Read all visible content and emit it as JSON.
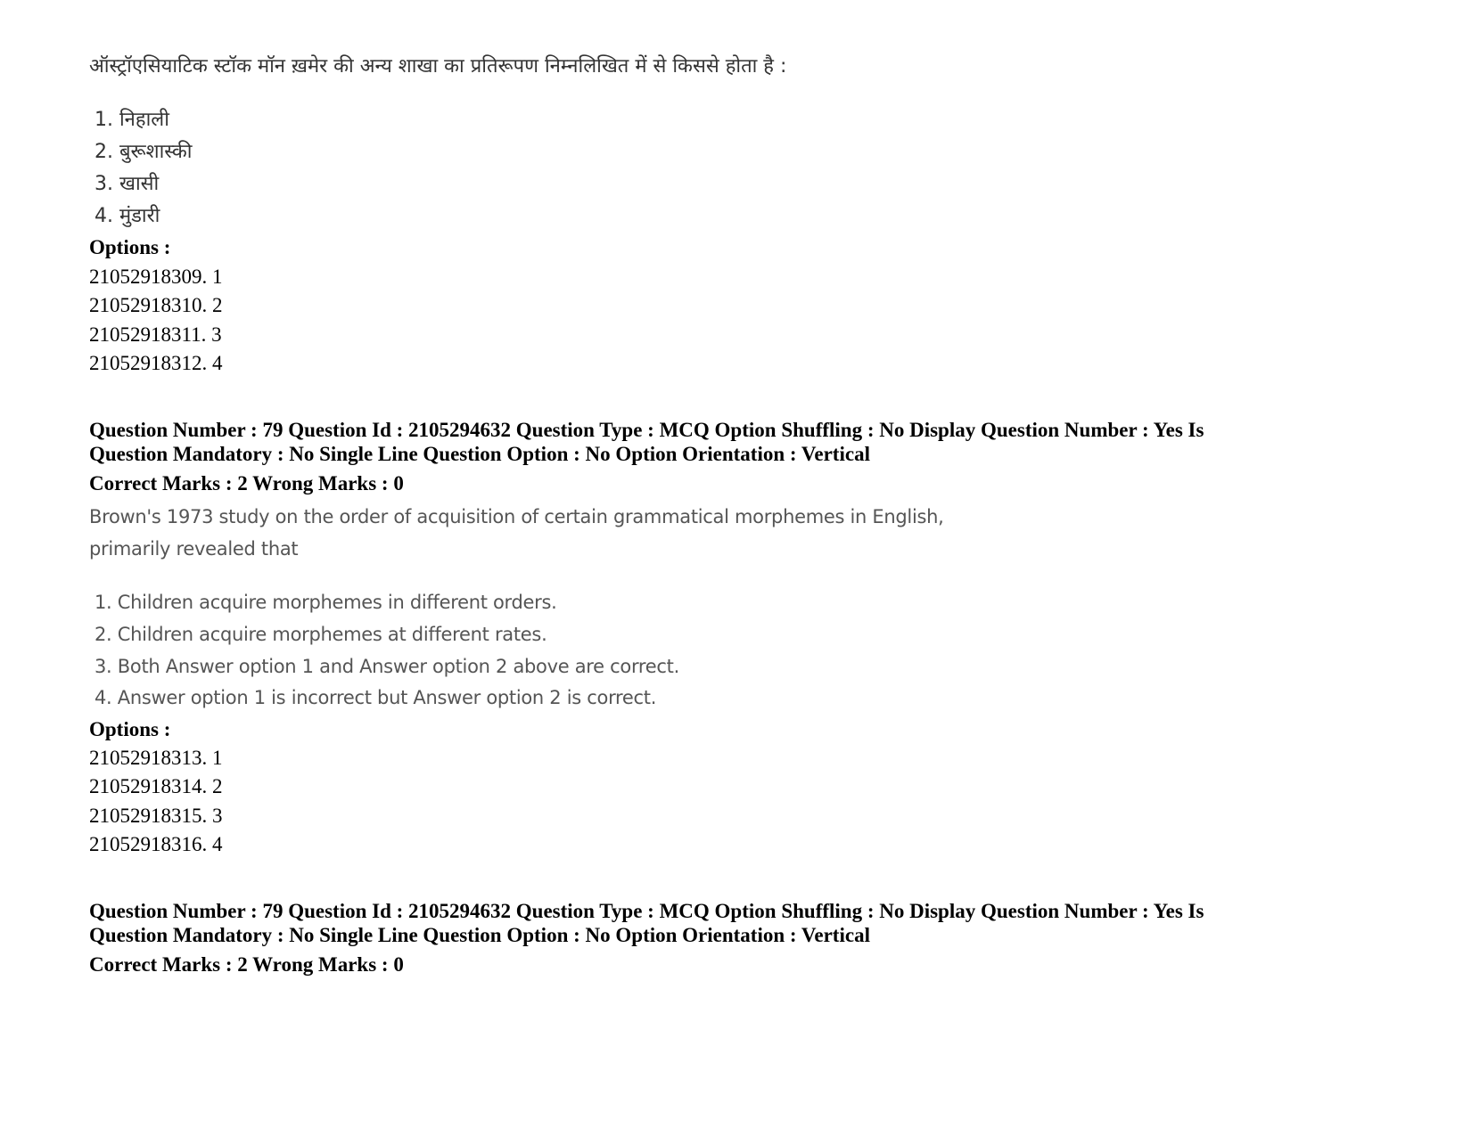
{
  "block1": {
    "question_text": "ऑस्ट्रॉएसियाटिक स्टॉक मॉन ख़मेर की अन्य शाखा का प्रतिरूपण निम्नलिखित में से किससे होता है :",
    "answer_choices": [
      "1. निहाली",
      "2. बुरूशास्की",
      "3. खासी",
      "4. मुंडारी"
    ],
    "options_label": "Options :",
    "options": [
      "21052918309. 1",
      "21052918310. 2",
      "21052918311. 3",
      "21052918312. 4"
    ]
  },
  "block2": {
    "meta_line1": "Question Number : 79 Question Id : 2105294632 Question Type : MCQ Option Shuffling : No Display Question Number : Yes Is",
    "meta_line2": "Question Mandatory : No Single Line Question Option : No Option Orientation : Vertical",
    "marks": "Correct Marks : 2 Wrong Marks : 0",
    "question_line1": "Brown's 1973 study on the order of acquisition of certain grammatical morphemes in English,",
    "question_line2": "primarily revealed that",
    "answer_choices": [
      "1. Children acquire morphemes in different orders.",
      "2. Children acquire morphemes at different rates.",
      "3. Both Answer option 1 and Answer option 2 above are correct.",
      "4. Answer option 1 is incorrect but Answer option 2 is correct."
    ],
    "options_label": "Options :",
    "options": [
      "21052918313. 1",
      "21052918314. 2",
      "21052918315. 3",
      "21052918316. 4"
    ]
  },
  "block3": {
    "meta_line1": "Question Number : 79 Question Id : 2105294632 Question Type : MCQ Option Shuffling : No Display Question Number : Yes Is",
    "meta_line2": "Question Mandatory : No Single Line Question Option : No Option Orientation : Vertical",
    "marks": "Correct Marks : 2 Wrong Marks : 0"
  }
}
